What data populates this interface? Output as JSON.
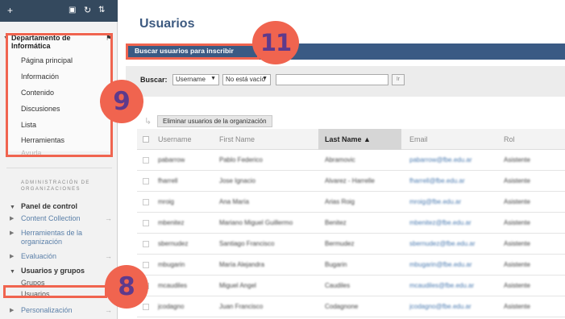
{
  "sidebar": {
    "toolbar": {
      "add_icon": "+",
      "icons": [
        "folder-icon",
        "refresh-icon",
        "sort-icon"
      ]
    },
    "course": {
      "title": "Departamento de Informática"
    },
    "course_links": [
      {
        "label": "Página principal"
      },
      {
        "label": "Información"
      },
      {
        "label": "Contenido"
      },
      {
        "label": "Discusiones"
      },
      {
        "label": "Lista"
      },
      {
        "label": "Herramientas"
      },
      {
        "label": "Ayuda"
      }
    ],
    "admin_heading": "ADMINISTRACIÓN DE ORGANIZACIONES",
    "panel_title": "Panel de control",
    "panel_items": [
      {
        "label": "Content Collection"
      },
      {
        "label": "Herramientas de la organización"
      },
      {
        "label": "Evaluación"
      }
    ],
    "users_group": {
      "title": "Usuarios y grupos",
      "items": [
        {
          "label": "Grupos"
        },
        {
          "label": "Usuarios"
        }
      ]
    },
    "personalization": {
      "label": "Personalización"
    }
  },
  "main": {
    "title": "Usuarios",
    "actionbar": {
      "enroll_button": "Buscar usuarios para inscribir"
    },
    "search": {
      "label": "Buscar:",
      "field_select": "Username",
      "operator_select": "No está vacío",
      "go_label": "Ir"
    },
    "remove_button": "Eliminar usuarios de la organización",
    "columns": [
      "Username",
      "First Name",
      "Last Name",
      "Email",
      "Rol"
    ],
    "rows": [
      {
        "username": "pabarrow",
        "first": "Pablo Federico",
        "last": "Abramovic",
        "email": "pabarrow@fbe.edu.ar",
        "role": "Asistente"
      },
      {
        "username": "fharrell",
        "first": "Jose Ignacio",
        "last": "Alvarez - Harrelle",
        "email": "fharrell@fbe.edu.ar",
        "role": "Asistente"
      },
      {
        "username": "mroig",
        "first": "Ana María",
        "last": "Arias Roig",
        "email": "mroig@fbe.edu.ar",
        "role": "Asistente"
      },
      {
        "username": "mbenitez",
        "first": "Mariano Miguel Guillermo",
        "last": "Benitez",
        "email": "mbenitez@fbe.edu.ar",
        "role": "Asistente"
      },
      {
        "username": "sbernudez",
        "first": "Santiago Francisco",
        "last": "Bermudez",
        "email": "sbernudez@fbe.edu.ar",
        "role": "Asistente"
      },
      {
        "username": "mbugarin",
        "first": "María Alejandra",
        "last": "Bugarin",
        "email": "mbugarin@fbe.edu.ar",
        "role": "Asistente"
      },
      {
        "username": "mcaudiles",
        "first": "Miguel Angel",
        "last": "Caudiles",
        "email": "mcaudiles@fbe.edu.ar",
        "role": "Asistente"
      },
      {
        "username": "jcodagno",
        "first": "Juan Francisco",
        "last": "Codagnone",
        "email": "jcodagno@fbe.edu.ar",
        "role": "Asistente"
      }
    ]
  },
  "annotations": {
    "badge_sidebar_course": "9",
    "badge_users": "8",
    "badge_enroll": "11"
  },
  "colors": {
    "accent_annotation": "#f0644f",
    "badge_number": "#5e3a8c",
    "actionbar": "#3a5a84",
    "toolbar": "#34495e"
  }
}
